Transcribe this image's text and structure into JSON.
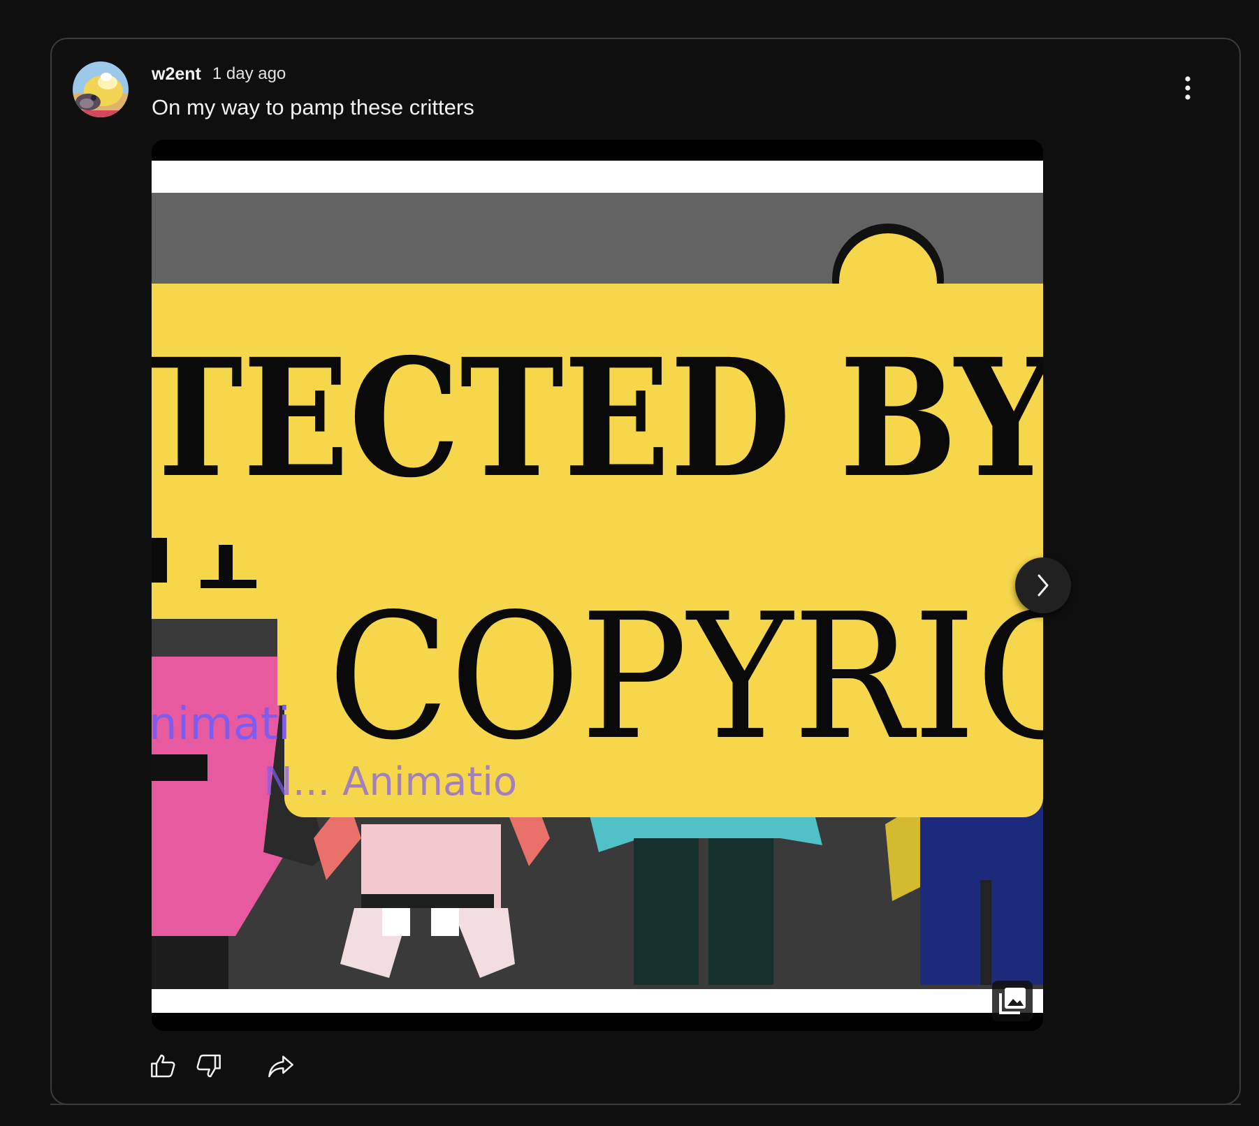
{
  "post": {
    "author": "w2ent",
    "time": "1 day ago",
    "text": "On my way to pamp these critters"
  },
  "image": {
    "banner_line1": "TECTED BY",
    "banner_line2": "COPYRIG",
    "overlay_small": "nimati",
    "overlay_faded": "N... Animatio",
    "colors": {
      "banner_yellow": "#f6d64a",
      "pink": "#e85aa0",
      "teal": "#4fc1c7",
      "navy": "#1b2a7a",
      "salmon": "#e9716a",
      "gold": "#d4ba2e",
      "purple_text": "#7f5cf0"
    }
  },
  "controls": {
    "more_icon": "more-vert-icon",
    "next_icon": "chevron-right-icon",
    "gallery_icon": "multiple-images-icon"
  },
  "actions": {
    "like_icon": "thumb-up-icon",
    "dislike_icon": "thumb-down-icon",
    "share_icon": "share-icon"
  },
  "theme": {
    "background": "#0f0f0f",
    "border": "#3a3a3a",
    "text": "#f1f1f1"
  }
}
